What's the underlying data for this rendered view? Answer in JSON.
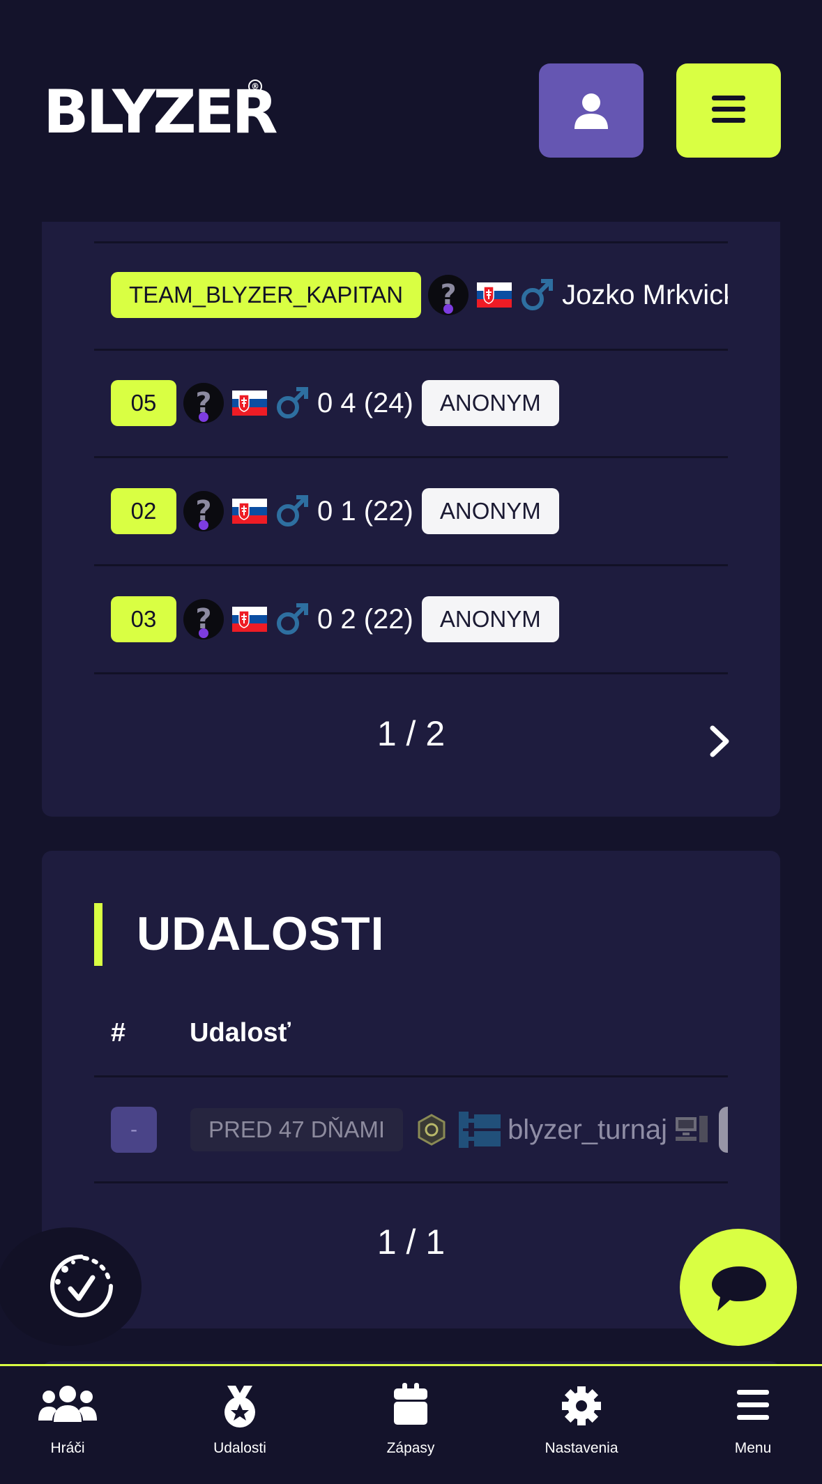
{
  "header": {
    "logo_text": "BLYZER",
    "logo_mark": "®",
    "user_button_icon": "user-icon",
    "menu_button_icon": "hamburger-icon"
  },
  "players": {
    "rows": [
      {
        "tag": "TEAM_BLYZER_KAPITAN",
        "name": "Jozko Mrkvicko",
        "badge": ""
      },
      {
        "tag": "05",
        "name": "0 4 (24)",
        "badge": "ANONYM"
      },
      {
        "tag": "02",
        "name": "0 1 (22)",
        "badge": "ANONYM"
      },
      {
        "tag": "03",
        "name": "0 2 (22)",
        "badge": "ANONYM"
      }
    ],
    "pager": "1 / 2"
  },
  "events": {
    "title": "UDALOSTI",
    "col_hash": "#",
    "col_event": "Udalosť",
    "row": {
      "index": "-",
      "when": "PRED 47 DŇAMI",
      "name": "blyzer_turnaj"
    },
    "pager": "1 / 1"
  },
  "nav": {
    "players": "Hráči",
    "events": "Udalosti",
    "matches": "Zápasy",
    "settings": "Nastavenia",
    "menu": "Menu"
  },
  "colors": {
    "accent": "#d9ff43",
    "purple": "#6556b2",
    "background": "#14132b",
    "card": "#1e1c3e",
    "male_symbol": "#2e6fa0"
  }
}
